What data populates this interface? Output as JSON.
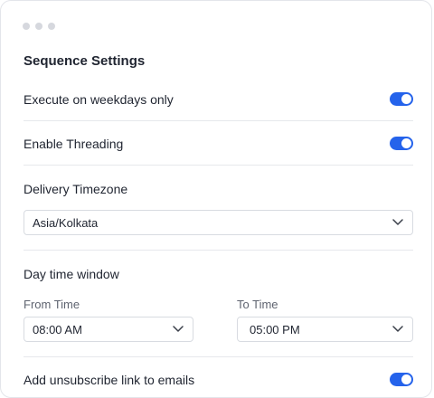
{
  "settings": {
    "title": "Sequence Settings",
    "weekdays_label": "Execute on weekdays only",
    "weekdays_enabled": true,
    "threading_label": "Enable Threading",
    "threading_enabled": true,
    "timezone_label": "Delivery Timezone",
    "timezone_value": "Asia/Kolkata",
    "time_window_label": "Day time window",
    "from_time_label": "From Time",
    "from_time_value": "08:00 AM",
    "to_time_label": "To Time",
    "to_time_value": "05:00 PM",
    "unsubscribe_label": "Add unsubscribe link to emails",
    "unsubscribe_enabled": true
  },
  "colors": {
    "accent": "#2563eb"
  },
  "icons": {
    "window_controls": "window-dots-icon",
    "dropdown": "chevron-down-icon"
  }
}
